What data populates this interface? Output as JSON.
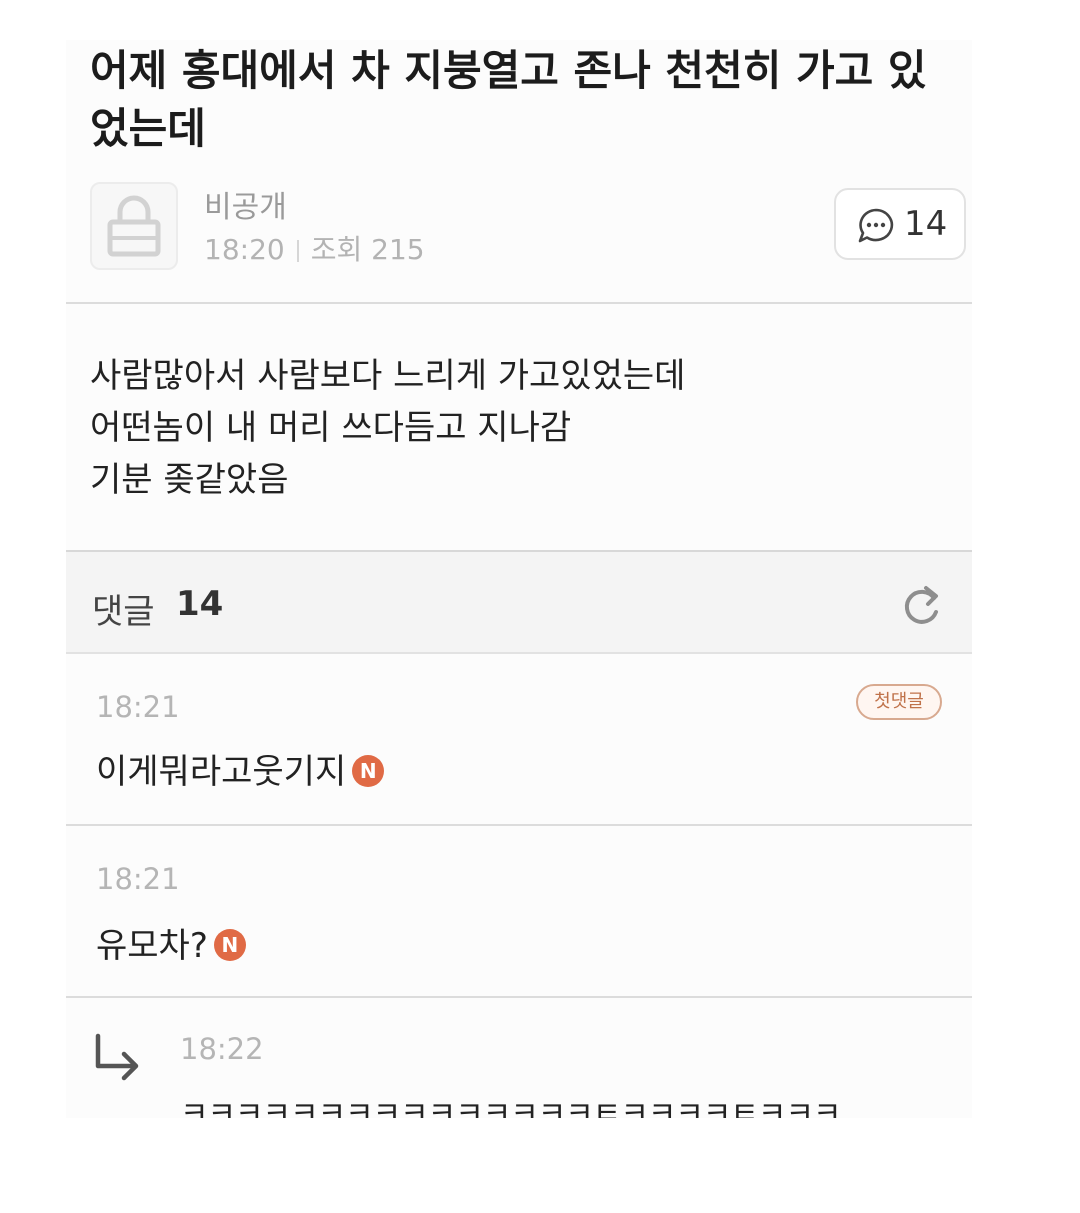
{
  "post": {
    "title": "어제 홍대에서 차 지붕열고 존나 천천히 가고 있었는데",
    "author": "비공개",
    "time": "18:20",
    "views_label": "조회 215",
    "comment_count": "14",
    "body_lines": [
      "사람많아서 사람보다 느리게 가고있었는데",
      "어떤놈이 내 머리 쓰다듬고 지나감",
      "기분  좆같았음"
    ]
  },
  "comments_header": {
    "label": "댓글",
    "count": "14"
  },
  "comments": [
    {
      "time": "18:21",
      "text": "이게뭐라고웃기지",
      "badge": "N",
      "tag": "첫댓글"
    },
    {
      "time": "18:21",
      "text": "유모차?",
      "badge": "N"
    },
    {
      "time": "18:22",
      "text": "ㅋㅋㅋㅋㅋㅋㅋㅋㅋㅋㅋㅋㅋㅋㅋㅌㅋㅋㅋㅋㅌㅋㅋㅋ",
      "is_reply": true
    }
  ],
  "icons": {
    "avatar": "lock-icon",
    "comment_button": "speech-bubble-icon",
    "refresh": "refresh-icon",
    "reply": "reply-arrow-icon"
  },
  "colors": {
    "new_badge": "#e06a45",
    "first_comment_badge": "#c0724a"
  }
}
